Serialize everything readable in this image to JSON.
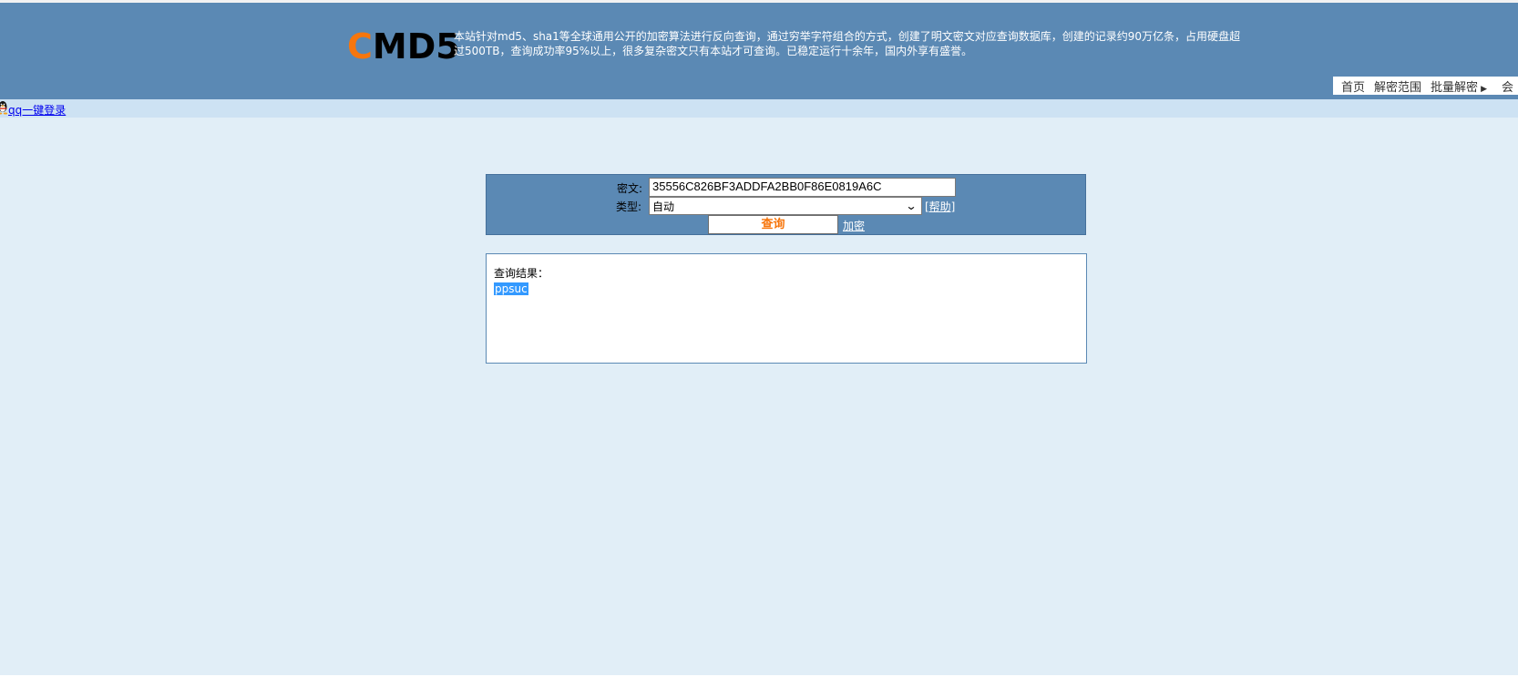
{
  "header": {
    "logo_c": "C",
    "logo_rest": "MD5",
    "intro": "本站针对md5、sha1等全球通用公开的加密算法进行反向查询，通过穷举字符组合的方式，创建了明文密文对应查询数据库，创建的记录约90万亿条，占用硬盘超过500TB，查询成功率95%以上，很多复杂密文只有本站才可查询。已稳定运行十余年，国内外享有盛誉。",
    "nav": {
      "home": "首页",
      "decrypt_range": "解密范围",
      "batch_decrypt": "批量解密",
      "member": "会"
    }
  },
  "subbar": {
    "qq_login": "qq一键登录"
  },
  "query": {
    "cipher_label": "密文:",
    "cipher_value": "35556C826BF3ADDFA2BB0F86E0819A6C",
    "type_label": "类型:",
    "type_selected": "自动",
    "help_link": "[帮助]",
    "query_button": "查询",
    "encrypt_link": "加密"
  },
  "result": {
    "label": "查询结果：",
    "value": "ppsuc"
  },
  "colors": {
    "header_bg": "#5b89b4",
    "page_bg": "#e1eef7",
    "subbar_bg": "#cde2f3",
    "accent_orange": "#f7760d",
    "selection_blue": "#3399ff"
  }
}
